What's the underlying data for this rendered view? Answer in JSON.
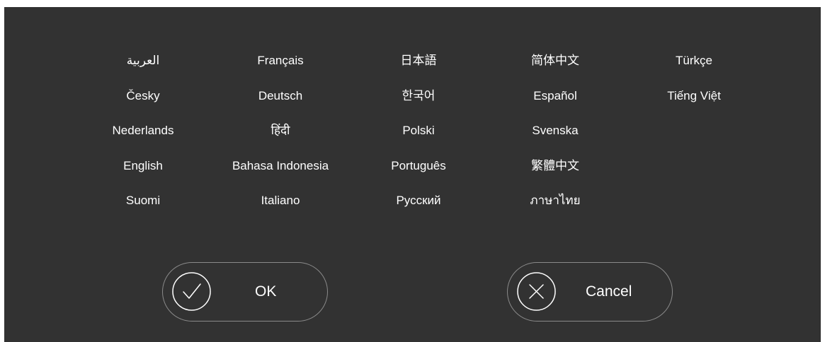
{
  "languages": [
    [
      "العربية",
      "Français",
      "日本語",
      "简体中文",
      "Türkçe"
    ],
    [
      "Česky",
      "Deutsch",
      "한국어",
      "Español",
      "Tiếng Việt"
    ],
    [
      "Nederlands",
      "हिंदी",
      "Polski",
      "Svenska"
    ],
    [
      "English",
      "Bahasa Indonesia",
      "Português",
      "繁體中文"
    ],
    [
      "Suomi",
      "Italiano",
      "Русский",
      "ภาษาไทย"
    ]
  ],
  "buttons": {
    "ok_label": "OK",
    "ok_icon": "check-icon",
    "cancel_label": "Cancel",
    "cancel_icon": "close-icon"
  },
  "colors": {
    "background": "#323232",
    "text": "#ffffff",
    "button_border": "#8a8a8a"
  }
}
